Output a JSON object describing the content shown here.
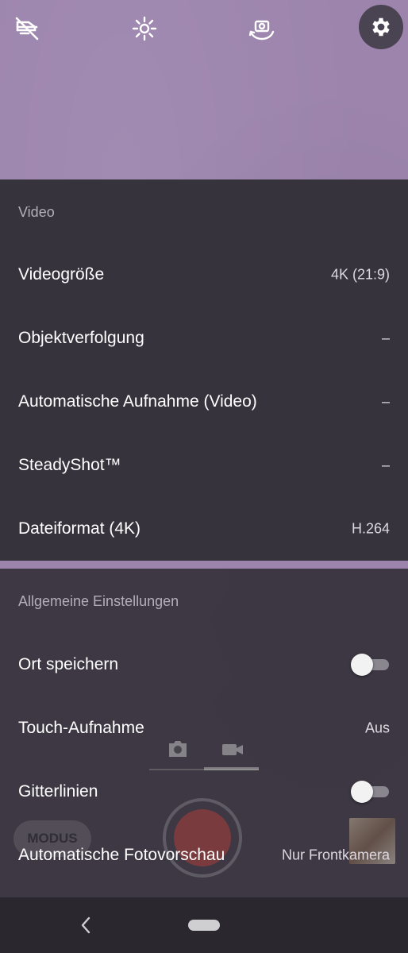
{
  "top_bar": {
    "icons": [
      "flash-off-icon",
      "brightness-icon",
      "switch-camera-icon",
      "settings-icon"
    ]
  },
  "video_section": {
    "title": "Video",
    "rows": [
      {
        "label": "Videogröße",
        "value": "4K (21:9)"
      },
      {
        "label": "Objektverfolgung",
        "value": "–"
      },
      {
        "label": "Automatische Aufnahme (Video)",
        "value": "–"
      },
      {
        "label": "SteadyShot™",
        "value": "–"
      },
      {
        "label": "Dateiformat (4K)",
        "value": "H.264"
      }
    ]
  },
  "general_section": {
    "title": "Allgemeine Einstellungen",
    "rows": [
      {
        "label": "Ort speichern",
        "toggle": false
      },
      {
        "label": "Touch-Aufnahme",
        "value": "Aus"
      },
      {
        "label": "Gitterlinien",
        "toggle": false
      },
      {
        "label": "Automatische Fotovorschau",
        "value": "Nur Frontkamera"
      }
    ]
  },
  "camera_controls": {
    "mode_label": "MODUS",
    "active_mode": "video"
  },
  "colors": {
    "viewfinder": "#9c84ad",
    "panel": "#37333d",
    "record": "#c2403a"
  }
}
